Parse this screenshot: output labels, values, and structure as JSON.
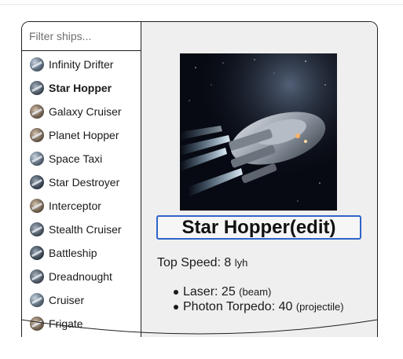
{
  "filter": {
    "placeholder": "Filter ships..."
  },
  "ships": [
    {
      "name": "Infinity Drifter",
      "active": false,
      "icon": "ship-thumbnail-icon"
    },
    {
      "name": "Star Hopper",
      "active": true,
      "icon": "ship-thumbnail-icon"
    },
    {
      "name": "Galaxy Cruiser",
      "active": false,
      "icon": "ship-thumbnail-icon"
    },
    {
      "name": "Planet Hopper",
      "active": false,
      "icon": "ship-thumbnail-icon"
    },
    {
      "name": "Space Taxi",
      "active": false,
      "icon": "ship-thumbnail-icon"
    },
    {
      "name": "Star Destroyer",
      "active": false,
      "icon": "ship-thumbnail-icon"
    },
    {
      "name": "Interceptor",
      "active": false,
      "icon": "ship-thumbnail-icon"
    },
    {
      "name": "Stealth Cruiser",
      "active": false,
      "icon": "ship-thumbnail-icon"
    },
    {
      "name": "Battleship",
      "active": false,
      "icon": "ship-thumbnail-icon"
    },
    {
      "name": "Dreadnought",
      "active": false,
      "icon": "ship-thumbnail-icon"
    },
    {
      "name": "Cruiser",
      "active": false,
      "icon": "ship-thumbnail-icon"
    },
    {
      "name": "Frigate",
      "active": false,
      "icon": "ship-thumbnail-icon"
    }
  ],
  "detail": {
    "title": "Star Hopper(edit)",
    "speed_label": "Top Speed: ",
    "speed_value": "8",
    "speed_unit": "lyh",
    "weapons": [
      {
        "label": "Laser: ",
        "value": "25",
        "type": "(beam)"
      },
      {
        "label": "Photon Torpedo: ",
        "value": "40",
        "type": "(projectile)"
      }
    ]
  },
  "colors": {
    "accent": "#2f64c9",
    "panel_bg": "#efefef",
    "border": "#1f1f1f"
  }
}
